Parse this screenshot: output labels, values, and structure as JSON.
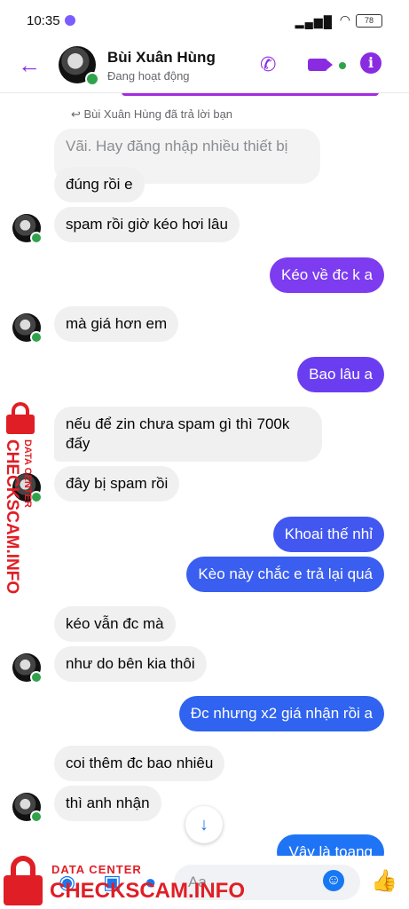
{
  "status_bar": {
    "time": "10:35",
    "battery": "78"
  },
  "header": {
    "name": "Bùi Xuân Hùng",
    "status": "Đang hoạt động"
  },
  "reply_note": "Bùi Xuân Hùng đã trả lời bạn",
  "messages": [
    {
      "text": "Vãi. Hay đăng nhập nhiều thiết bị"
    },
    {
      "text": "đúng rồi e"
    },
    {
      "text": "spam rồi giờ kéo hơi lâu"
    },
    {
      "text": "Kéo về đc k a"
    },
    {
      "text": "mà giá hơn em"
    },
    {
      "text": "Bao lâu a"
    },
    {
      "text": "nếu để zin chưa spam gì thì 700k"
    },
    {
      "text": "đấy"
    },
    {
      "text": "đây bị spam rồi"
    },
    {
      "text": "Khoai thế nhỉ"
    },
    {
      "text": "Kèo này chắc e trả lại quá"
    },
    {
      "text": "kéo vẫn đc mà"
    },
    {
      "text": "như do bên kia thôi"
    },
    {
      "text": "Đc nhưng x2 giá nhận rồi a"
    },
    {
      "text": "coi thêm đc bao nhiêu"
    },
    {
      "text": "thì anh nhận"
    },
    {
      "text": "Vậy là toang"
    }
  ],
  "composer": {
    "placeholder": "Aa"
  },
  "watermark": {
    "data_center": "DATA CENTER",
    "site": "CHECKSCAM.INFO"
  },
  "colors": {
    "accent": "#8a2be2",
    "bubble_purple": "#7d3cf0",
    "bubble_blue": "#2f63f0",
    "incoming": "#f0f0f0",
    "watermark": "#e01e25"
  }
}
